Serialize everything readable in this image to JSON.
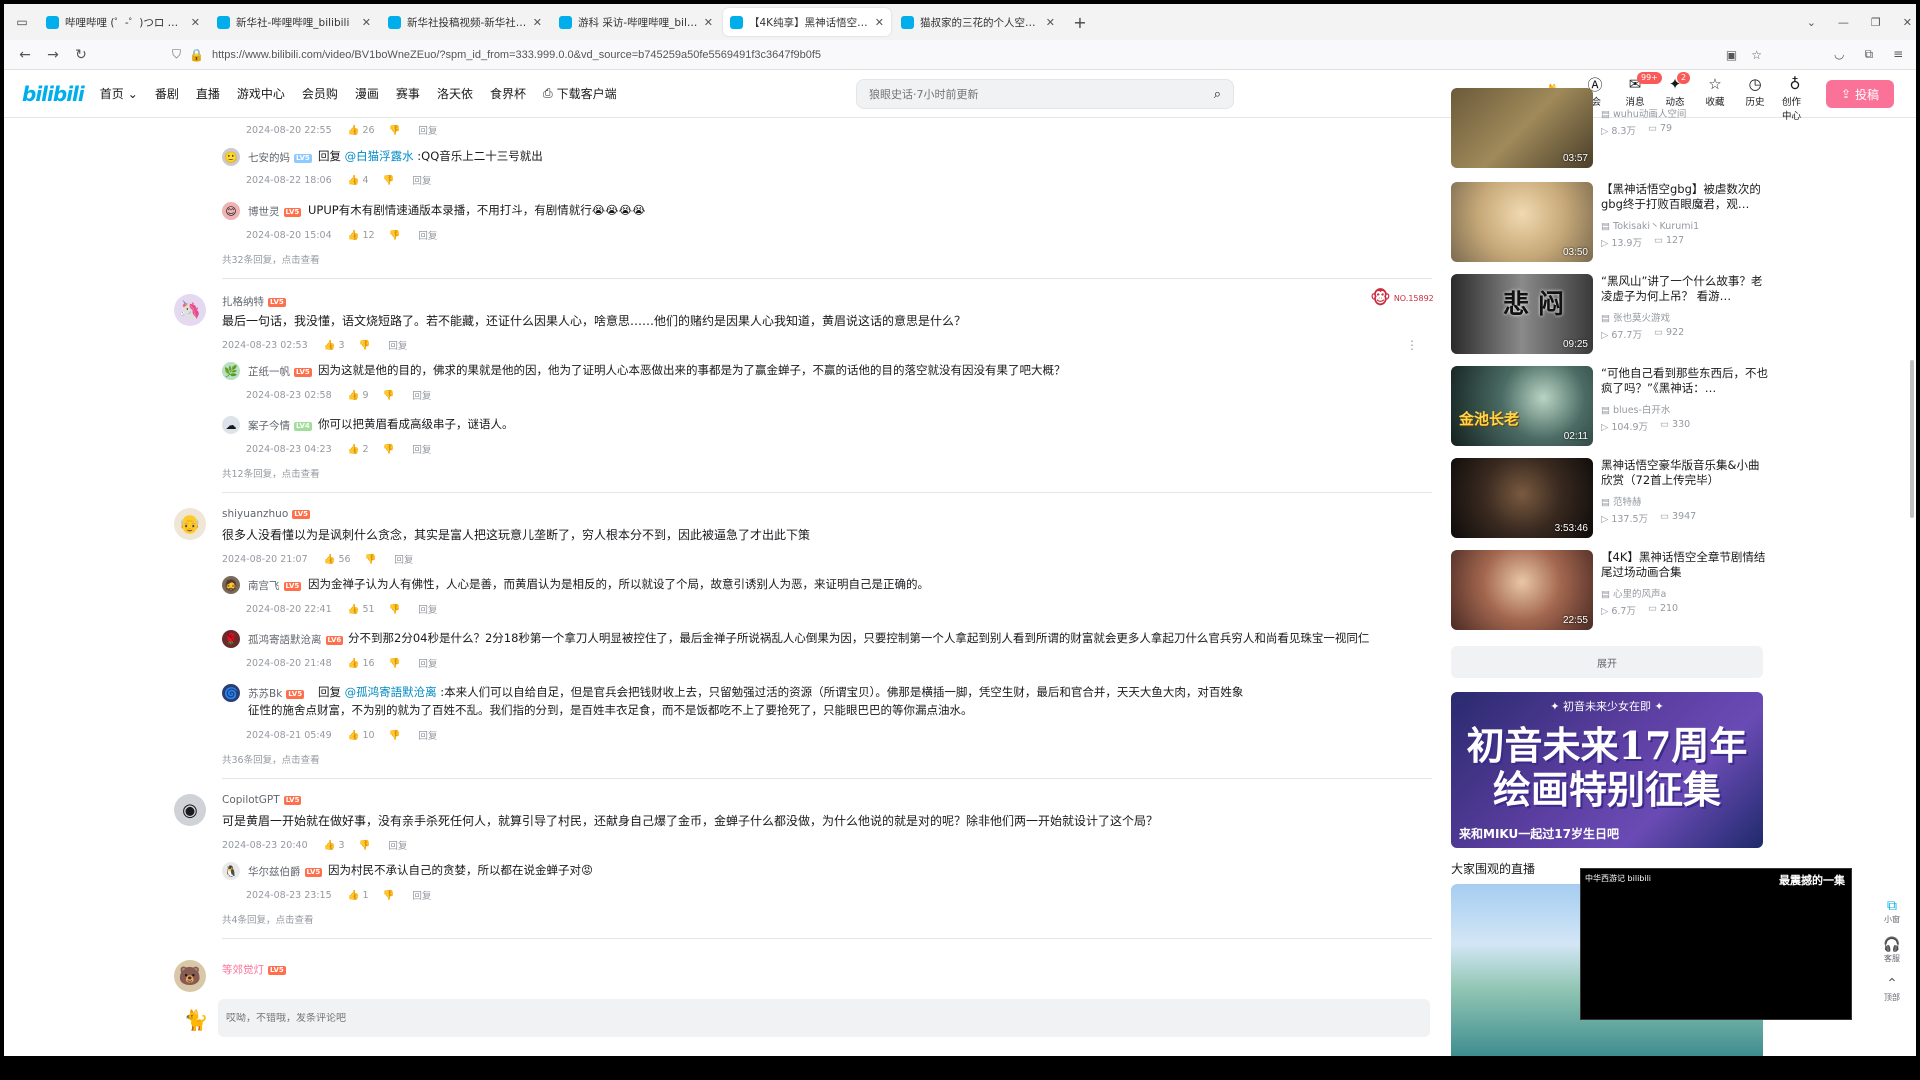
{
  "browser": {
    "tabs": [
      {
        "label": "哔哩哔哩 (゜-゜)つロ 干杯~-bi"
      },
      {
        "label": "新华社-哔哩哔哩_bilibili"
      },
      {
        "label": "新华社投稿视频-新华社视频分"
      },
      {
        "label": "游科 采访-哔哩哔哩_bilibili"
      },
      {
        "label": "【4K纯享】黑神话悟空章节动画"
      },
      {
        "label": "猫叔家的三花的个人空间-猫叔"
      }
    ],
    "active_tab": 4,
    "url": "https://www.bilibili.com/video/BV1boWneZEuo/?spm_id_from=333.999.0.0&vd_source=b745259a50fe5569491f3c3647f9b0f5"
  },
  "header": {
    "logo": "bilibili",
    "nav": [
      "首页",
      "番剧",
      "直播",
      "游戏中心",
      "会员购",
      "漫画",
      "赛事",
      "洛天依",
      "食界杯",
      "下载客户端"
    ],
    "search_placeholder": "狼眼史话·7小时前更新",
    "right_items": [
      {
        "label": "大会员",
        "icon": "vip-icon",
        "badge": ""
      },
      {
        "label": "消息",
        "icon": "message-icon",
        "badge": "99+"
      },
      {
        "label": "动态",
        "icon": "dynamic-icon",
        "badge": "2"
      },
      {
        "label": "收藏",
        "icon": "star-icon",
        "badge": ""
      },
      {
        "label": "历史",
        "icon": "clock-icon",
        "badge": ""
      },
      {
        "label": "创作中心",
        "icon": "bulb-icon",
        "badge": ""
      }
    ],
    "upload": "投稿"
  },
  "comments": {
    "top_partial": {
      "time": "2024-08-20 22:55",
      "likes": "26",
      "reply": "回复"
    },
    "thread1_replies": [
      {
        "user": "七安的妈",
        "lv": "LV5",
        "prefix": "回复 ",
        "mention": "@白猫浮露水",
        "text": " :QQ音乐上二十三号就出",
        "time": "2024-08-22 18:06",
        "likes": "4",
        "reply": "回复"
      },
      {
        "user": "博世灵",
        "lv": "LV5",
        "prefix": "",
        "mention": "",
        "text": "UPUP有木有剧情速通版本录播，不用打斗，有剧情就行😭😭😭😭",
        "time": "2024-08-20 15:04",
        "likes": "12",
        "reply": "回复"
      }
    ],
    "thread1_more": "共32条回复，点击查看",
    "thread2": {
      "user": "扎格纳特",
      "lv": "LV5",
      "text": "最后一句话，我没懂，语文烧短路了。若不能藏，还证什么因果人心，啥意思……他们的赌约是因果人心我知道，黄眉说这话的意思是什么？",
      "time": "2024-08-23 02:53",
      "likes": "3",
      "reply": "回复",
      "medal": "NO.158928",
      "replies": [
        {
          "user": "芷纸一帆",
          "lv": "LV5",
          "text": "因为这就是他的目的，佛求的果就是他的因，他为了证明人心本恶做出来的事都是为了赢金蝉子，不赢的话他的目的落空就没有因没有果了吧大概？",
          "time": "2024-08-23 02:58",
          "likes": "9",
          "reply": "回复"
        },
        {
          "user": "案子今情",
          "lv": "LV4",
          "text": "你可以把黄眉看成高级串子，谜语人。",
          "time": "2024-08-23 04:23",
          "likes": "2",
          "reply": "回复"
        }
      ],
      "more": "共12条回复，点击查看"
    },
    "thread3": {
      "user": "shiyuanzhuo",
      "lv": "LV5",
      "text": "很多人没看懂以为是讽刺什么贪念，其实是富人把这玩意儿垄断了，穷人根本分不到，因此被逼急了才出此下策",
      "time": "2024-08-20 21:07",
      "likes": "56",
      "reply": "回复",
      "replies": [
        {
          "user": "南宫飞",
          "lv": "LV5",
          "text": "因为金禅子认为人有佛性，人心是善，而黄眉认为是相反的，所以就设了个局，故意引诱别人为恶，来证明自己是正确的。",
          "time": "2024-08-20 22:41",
          "likes": "51",
          "reply": "回复"
        },
        {
          "user": "孤鸿寄語默沧离",
          "lv": "LV6",
          "text": "分不到那2分04秒是什么？2分18秒第一个拿刀人明显被控住了，最后金禅子所说祸乱人心倒果为因，只要控制第一个人拿起到别人看到所谓的财富就会更多人拿起刀什么官兵穷人和尚看见珠宝一视同仁",
          "time": "2024-08-20 21:48",
          "likes": "16",
          "reply": "回复"
        },
        {
          "user": "苏苏Bk",
          "lv": "LV5",
          "prefix": "回复 ",
          "mention": "@孤鸿寄語默沧离",
          "text": " :本来人们可以自给自足，但是官兵会把钱财收上去，只留勉强过活的资源（所谓宝贝）。佛那是横插一脚，凭空生财，最后和官合并，天天大鱼大肉，对百姓象征性的施舍点财富，不为别的就为了百姓不乱。我们指的分到，是百姓丰衣足食，而不是饭都吃不上了要抢死了，只能眼巴巴的等你漏点油水。",
          "time": "2024-08-21 05:49",
          "likes": "10",
          "reply": "回复"
        }
      ],
      "more": "共36条回复，点击查看"
    },
    "thread4": {
      "user": "CopilotGPT",
      "lv": "LV5",
      "text": "可是黄眉一开始就在做好事，没有亲手杀死任何人，就算引导了村民，还献身自己爆了金币，金蝉子什么都没做，为什么他说的就是对的呢？除非他们两一开始就设计了这个局？",
      "time": "2024-08-23 20:40",
      "likes": "3",
      "reply": "回复",
      "replies": [
        {
          "user": "华尔兹伯爵",
          "lv": "LV5",
          "text": "因为村民不承认自己的贪婪，所以都在说金蝉子对😡",
          "time": "2024-08-23 23:15",
          "likes": "1",
          "reply": "回复"
        }
      ],
      "more": "共4条回复，点击查看"
    },
    "thread5": {
      "user": "等郊觉灯",
      "lv": "LV5"
    },
    "input_placeholder": "哎呦，不错哦，发条评论吧"
  },
  "sidebar": {
    "top_partial": {
      "up": "wuhu动画人空间",
      "views": "8.3万",
      "danmaku": "79",
      "duration": "03:57"
    },
    "recs": [
      {
        "title": "【黑神话悟空gbg】被虐数次的gbg终于打败百眼魔君，观…",
        "up": "Tokisaki丶Kurumi1",
        "views": "13.9万",
        "danmaku": "127",
        "duration": "03:50"
      },
      {
        "title": "“黑风山”讲了一个什么故事？老凌虚子为何上吊？ 看游…",
        "up": "张也莫火游戏",
        "views": "67.7万",
        "danmaku": "922",
        "duration": "09:25"
      },
      {
        "title": "“可他自己看到那些东西后，不也疯了吗？”《黑神话：…",
        "up": "blues-白开水",
        "views": "104.9万",
        "danmaku": "330",
        "duration": "02:11"
      },
      {
        "title": "黑神话悟空豪华版音乐集&小曲欣赏（72首上传完毕）",
        "up": "范特赫",
        "views": "137.5万",
        "danmaku": "3947",
        "duration": "3:53:46"
      },
      {
        "title": "【4K】黑神话悟空全章节剧情结尾过场动画合集",
        "up": "心里的风声a",
        "views": "6.7万",
        "danmaku": "210",
        "duration": "22:55"
      }
    ],
    "thumb_texts": {
      "t2": "悲 闷",
      "t3": "金池长老"
    },
    "expand": "展开",
    "banner": {
      "line1": "✦ 初音未来少女在即 ✦",
      "line2": "初音未来17周年绘画特别征集",
      "line3": "来和MIKU一起过17岁生日吧"
    },
    "live_title": "大家围观的直播",
    "mini_player_title": "最震撼的一集",
    "mini_player_logo": "中华西游记 bilibili",
    "tools": [
      "小窗",
      "客服",
      "顶部"
    ]
  }
}
